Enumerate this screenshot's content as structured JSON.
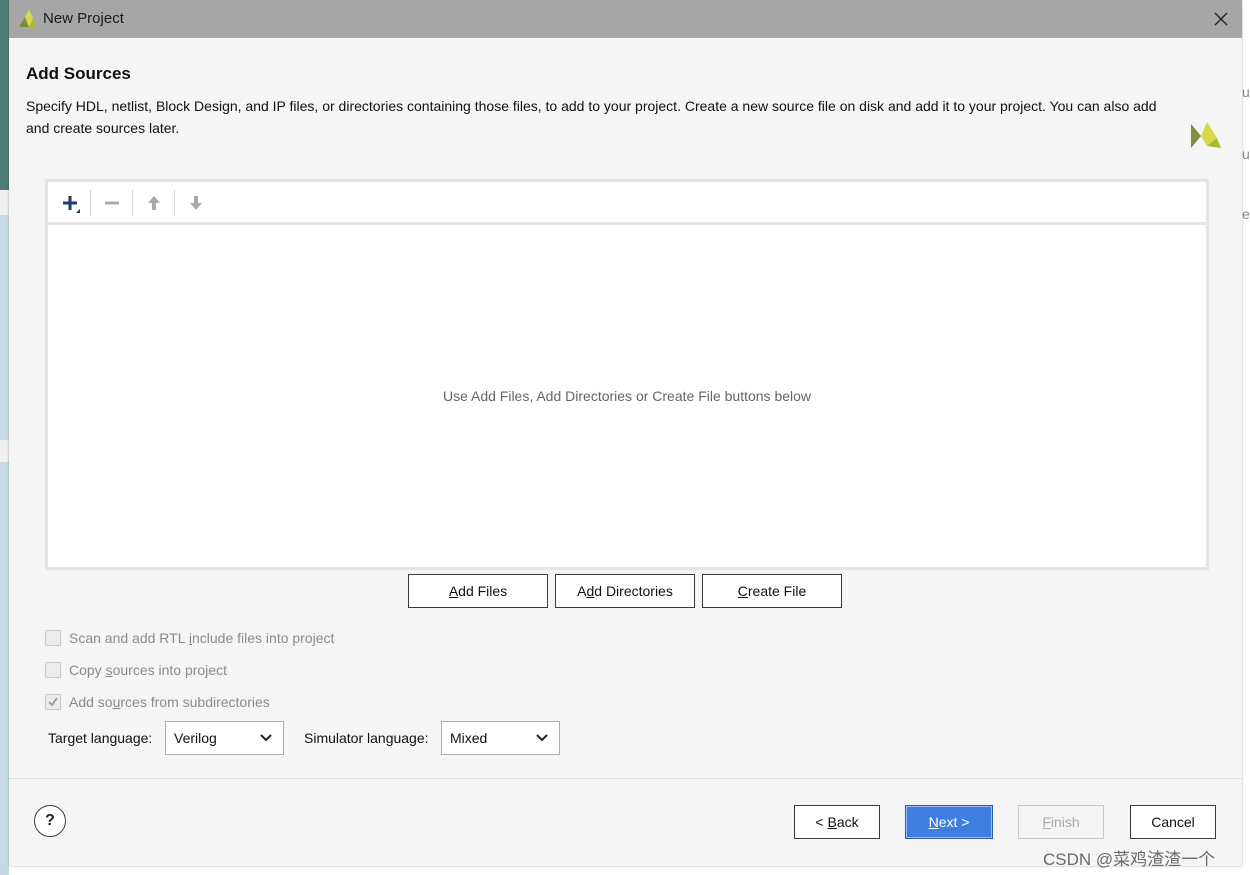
{
  "window": {
    "title": "New Project"
  },
  "header": {
    "heading": "Add Sources",
    "description": "Specify HDL, netlist, Block Design, and IP files, or directories containing those files, to add to your project. Create a new source file on disk and add it to your project. You can also add and create sources later."
  },
  "file_list": {
    "empty_text": "Use Add Files, Add Directories or Create File buttons below"
  },
  "actions": {
    "add_files": {
      "mnemonic": "A",
      "rest": "dd Files"
    },
    "add_directories": {
      "pre": "A",
      "mnemonic": "d",
      "rest": "d Directories"
    },
    "create_file": {
      "mnemonic": "C",
      "rest": "reate File"
    }
  },
  "options": {
    "scan_rtl": {
      "pre": "Scan and add RTL ",
      "mnemonic": "i",
      "rest": "nclude files into project",
      "checked": false
    },
    "copy_sources": {
      "pre": "Copy ",
      "mnemonic": "s",
      "rest": "ources into project",
      "checked": false
    },
    "add_subdirs": {
      "pre": "Add so",
      "mnemonic": "u",
      "rest": "rces from subdirectories",
      "checked": true
    }
  },
  "languages": {
    "target_label": "Target language:",
    "target_value": "Verilog",
    "simulator_label": "Simulator language:",
    "simulator_value": "Mixed"
  },
  "footer": {
    "help": "?",
    "back": {
      "pre": "< ",
      "mnemonic": "B",
      "rest": "ack"
    },
    "next": {
      "mnemonic": "N",
      "rest": "ext >"
    },
    "finish": {
      "mnemonic": "F",
      "rest": "inish"
    },
    "cancel": "Cancel"
  },
  "watermark": "CSDN @菜鸡渣渣一个",
  "colors": {
    "accent": "#3d7ee0",
    "logo_yellow": "#d8d84a",
    "logo_green": "#7d8f3a",
    "title_bar": "#a6a6a6"
  },
  "background_app": {
    "right_edge_glyphs": [
      "u",
      "u",
      "e"
    ]
  }
}
